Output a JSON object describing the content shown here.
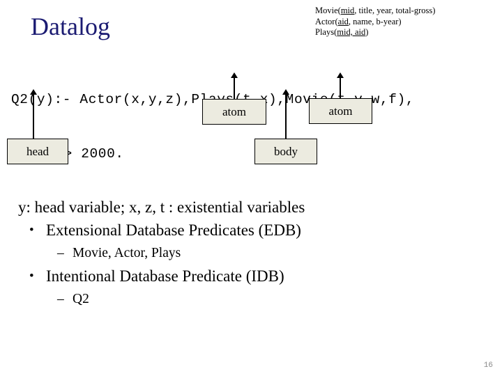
{
  "slide": {
    "title": "Datalog",
    "title_color": "#1b1b72",
    "background": "#ffffff",
    "page_number": "16"
  },
  "schema": {
    "lines": [
      {
        "relation": "Movie",
        "open": "(",
        "key": "mid",
        "rest": ", title, year, total-gross)"
      },
      {
        "relation": "Actor",
        "open": "(",
        "key": "aid",
        "rest": ", name, b-year)"
      },
      {
        "relation": "Plays",
        "open": "(",
        "key": "mid, aid",
        "rest": ")"
      }
    ],
    "full_text": [
      "Movie(mid, title, year, total-gross)",
      "Actor(aid, name, b-year)",
      "Plays(mid, aid)"
    ]
  },
  "rule": {
    "line1": "Q2(y):- Actor(x,y,z),Plays(t,x),Movie(t,v,w,f),",
    "line2": "f > 2000."
  },
  "boxes": {
    "fill_color": "#ECEBE0",
    "border_color": "#000000",
    "atom_left": "atom",
    "atom_right": "atom",
    "head": "head",
    "body": "body"
  },
  "bullets": {
    "intro": "y: head variable; x, z, t : existential variables",
    "items": [
      {
        "bullet": "•",
        "text": "Extensional Database Predicates (EDB)"
      },
      {
        "bullet": "•",
        "text": "Intentional Database Predicate (IDB)"
      }
    ],
    "sub_items": [
      {
        "dash": "–",
        "text": "Movie, Actor, Plays"
      },
      {
        "dash": "–",
        "text": "Q2"
      }
    ]
  }
}
